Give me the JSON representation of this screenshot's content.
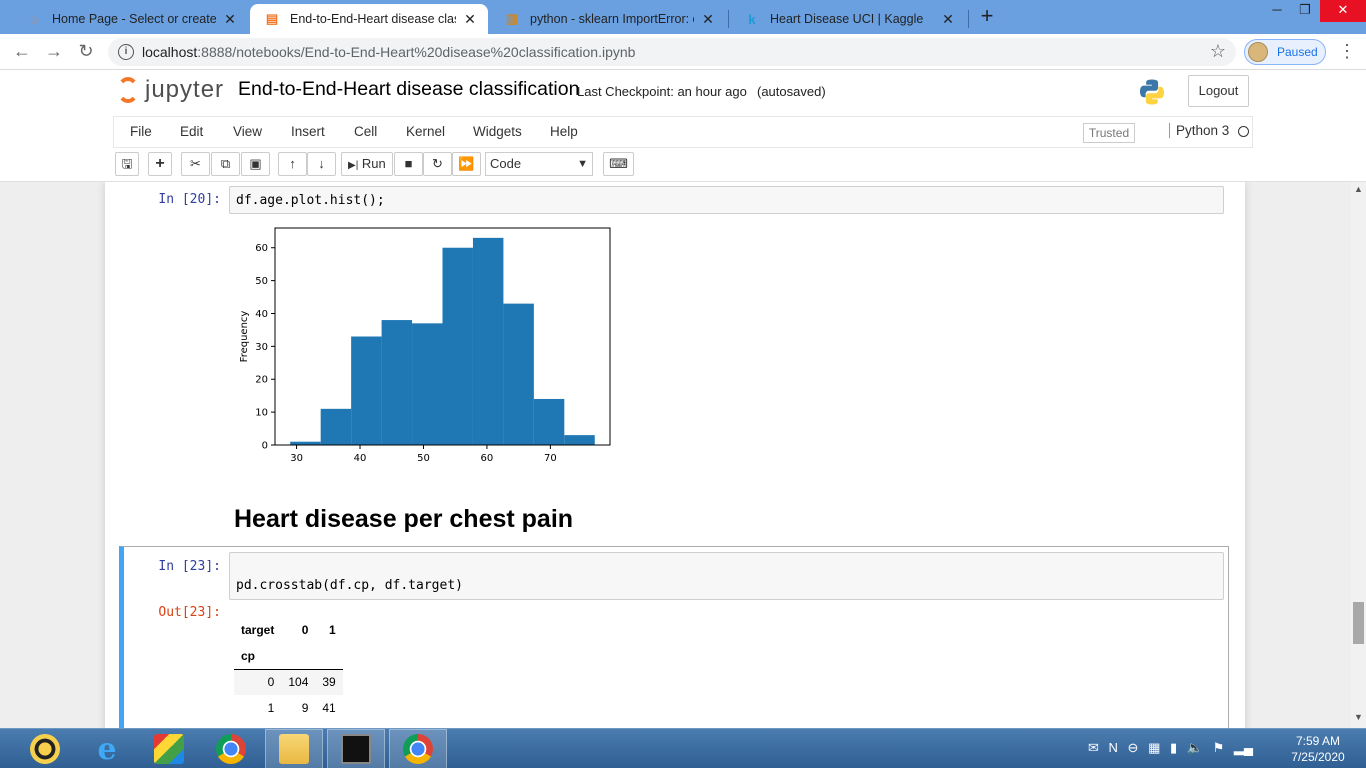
{
  "browser": {
    "tabs": [
      {
        "title": "Home Page - Select or create a n",
        "icon": "jupyter-icon",
        "active": false
      },
      {
        "title": "End-to-End-Heart disease classifi",
        "icon": "notebook-icon",
        "active": true
      },
      {
        "title": "python - sklearn ImportError: can",
        "icon": "stackoverflow-icon",
        "active": false
      },
      {
        "title": "Heart Disease UCI | Kaggle",
        "icon": "kaggle-icon",
        "active": false
      }
    ],
    "url_host": "localhost",
    "url_path": ":8888/notebooks/End-to-End-Heart%20disease%20classification.ipynb",
    "profile_label": "Paused"
  },
  "jupyter": {
    "logo_text": "jupyter",
    "notebook_name": "End-to-End-Heart disease classification",
    "checkpoint": "Last Checkpoint: an hour ago",
    "autosave": "(autosaved)",
    "logout_label": "Logout",
    "menu": [
      "File",
      "Edit",
      "View",
      "Insert",
      "Cell",
      "Kernel",
      "Widgets",
      "Help"
    ],
    "trusted_label": "Trusted",
    "kernel_name": "Python 3",
    "run_label": "Run",
    "cell_type": "Code"
  },
  "cells": {
    "c20": {
      "prompt": "In [20]:",
      "code": "df.age.plot.hist();"
    },
    "heading": "Heart disease per chest pain",
    "c23": {
      "prompt": "In [23]:",
      "code": "pd.crosstab(df.cp, df.target)",
      "out_prompt": "Out[23]:"
    }
  },
  "crosstab": {
    "header": [
      "target",
      "0",
      "1"
    ],
    "index_name": "cp",
    "rows": [
      [
        "0",
        "104",
        "39"
      ],
      [
        "1",
        "9",
        "41"
      ]
    ]
  },
  "chart_data": {
    "type": "bar",
    "title": "",
    "xlabel": "",
    "ylabel": "Frequency",
    "bins": [
      29.0,
      33.8,
      38.6,
      43.4,
      48.2,
      53.0,
      57.8,
      62.6,
      67.4,
      72.2,
      77.0
    ],
    "values": [
      1,
      11,
      33,
      38,
      37,
      60,
      63,
      43,
      14,
      3
    ],
    "xticks": [
      30,
      40,
      50,
      60,
      70
    ],
    "yticks": [
      0,
      10,
      20,
      30,
      40,
      50,
      60
    ],
    "xlim": [
      26.6,
      79.4
    ],
    "ylim": [
      0,
      66
    ],
    "color": "#1f77b4",
    "grid": false
  },
  "taskbar": {
    "time": "7:59 AM",
    "date": "7/25/2020"
  }
}
